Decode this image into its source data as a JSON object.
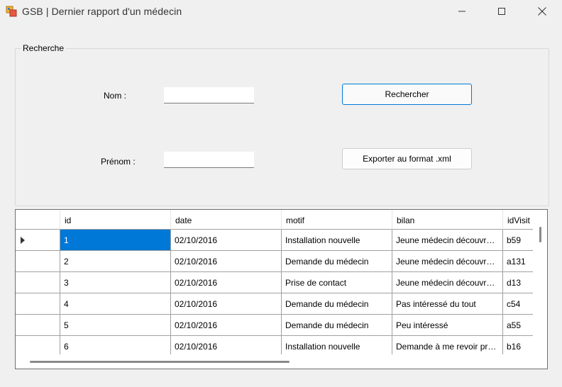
{
  "window": {
    "title": "GSB | Dernier rapport d'un médecin",
    "icon": "windows-forms-app-icon",
    "controls": [
      "minimize-icon",
      "maximize-icon",
      "close-icon"
    ]
  },
  "search": {
    "group_title": "Recherche",
    "nom_label": "Nom :",
    "nom_value": "",
    "prenom_label": "Prénom :",
    "prenom_value": "",
    "search_button": "Rechercher",
    "export_button": "Exporter au format .xml"
  },
  "grid": {
    "columns": [
      "id",
      "date",
      "motif",
      "bilan",
      "idVisit"
    ],
    "rows": [
      {
        "id": "1",
        "date": "02/10/2016",
        "motif": "Installation nouvelle",
        "bilan": "Jeune médecin découvrant le métier",
        "idVisit": "b59",
        "current": true
      },
      {
        "id": "2",
        "date": "02/10/2016",
        "motif": "Demande du médecin",
        "bilan": "Jeune médecin découvrant le métier",
        "idVisit": "a131"
      },
      {
        "id": "3",
        "date": "02/10/2016",
        "motif": "Prise de contact",
        "bilan": "Jeune médecin découvrant le métier",
        "idVisit": "d13"
      },
      {
        "id": "4",
        "date": "02/10/2016",
        "motif": "Demande du médecin",
        "bilan": "Pas intéressé du tout",
        "idVisit": "c54"
      },
      {
        "id": "5",
        "date": "02/10/2016",
        "motif": "Demande du médecin",
        "bilan": "Peu intéressé",
        "idVisit": "a55"
      },
      {
        "id": "6",
        "date": "02/10/2016",
        "motif": "Installation nouvelle",
        "bilan": "Demande à me revoir prochainement",
        "idVisit": "b16"
      }
    ],
    "selected_cell": {
      "row": 0,
      "column": "id"
    }
  },
  "colors": {
    "window_bg": "#f0f0f0",
    "selection": "#0078d7",
    "default_button_border": "#0078d7"
  }
}
